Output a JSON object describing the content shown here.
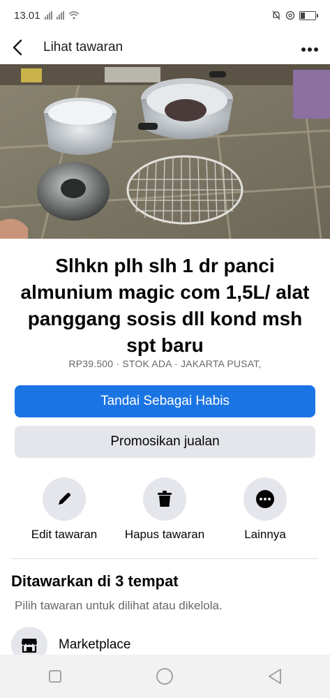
{
  "status_bar": {
    "time": "13.01"
  },
  "app_bar": {
    "title": "Lihat tawaran",
    "back_icon": "chevron-left-icon",
    "more_icon": "more-horizontal-icon"
  },
  "carousel": {
    "image_count": 7,
    "active_index": 0
  },
  "listing": {
    "title": "Slhkn plh slh 1 dr panci almunium magic com 1,5L/ alat panggang sosis dll kond msh spt baru",
    "meta": "RP39.500 · STOK ADA · JAKARTA PUSAT,"
  },
  "buttons": {
    "primary": "Tandai Sebagai Habis",
    "secondary": "Promosikan jualan"
  },
  "actions": [
    {
      "label": "Edit tawaran",
      "icon": "pencil-icon"
    },
    {
      "label": "Hapus tawaran",
      "icon": "trash-icon"
    },
    {
      "label": "Lainnya",
      "icon": "more-icon"
    }
  ],
  "offered": {
    "title": "Ditawarkan di 3 tempat",
    "subtitle": "Pilih tawaran untuk dilihat atau dikelola.",
    "items": [
      {
        "label": "Marketplace",
        "icon": "storefront-icon"
      }
    ]
  },
  "colors": {
    "primary": "#1b74e4",
    "secondary_bg": "#e4e6eb",
    "muted_text": "#65676b"
  }
}
